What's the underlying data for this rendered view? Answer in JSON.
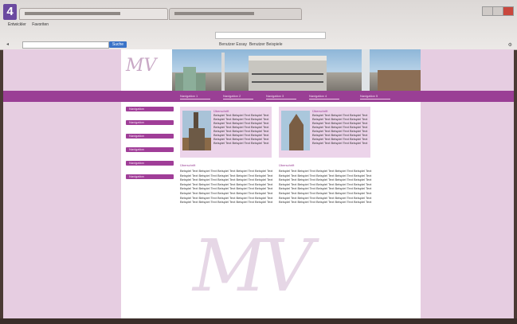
{
  "step_badge": "4",
  "browser": {
    "tabs": [
      "",
      ""
    ],
    "menu": [
      "Entwickler",
      "Favoriten"
    ],
    "url": "",
    "search_placeholder": "",
    "search_button": "Suche",
    "bookmarks": [
      "Benutzer Essay",
      "Benutzer Beispiele"
    ]
  },
  "page": {
    "logo": "MV",
    "nav": [
      "Navigation 1",
      "Navigation 2",
      "Navigation 3",
      "Navigation 4",
      "Navigation 5"
    ],
    "sidebar": [
      "Navigation",
      "Navigation",
      "Navigation",
      "Navigation",
      "Navigation",
      "Navigation"
    ],
    "cards": [
      {
        "title": "Überschrift",
        "text": "Beispiel Text Beispiel Text Beispiel Text Beispiel Text Beispiel Text Beispiel Text Beispiel Text Beispiel Text Beispiel Text Beispiel Text Beispiel Text Beispiel Text Beispiel Text Beispiel Text Beispiel Text Beispiel Text Beispiel Text Beispiel Text Beispiel Text Beispiel Text Beispiel Text Beispiel Text Beispiel Text Beispiel Text"
      },
      {
        "title": "Überschrift",
        "text": "Beispiel Text Beispiel Text Beispiel Text Beispiel Text Beispiel Text Beispiel Text Beispiel Text Beispiel Text Beispiel Text Beispiel Text Beispiel Text Beispiel Text Beispiel Text Beispiel Text Beispiel Text Beispiel Text Beispiel Text Beispiel Text Beispiel Text Beispiel Text Beispiel Text Beispiel Text Beispiel Text Beispiel Text"
      }
    ],
    "columns": [
      {
        "title": "Überschrift",
        "text": "Beispiel Text Beispiel Text Beispiel Text Beispiel Text Beispiel Text Beispiel Text Beispiel Text Beispiel Text Beispiel Text Beispiel Text Beispiel Text Beispiel Text Beispiel Text Beispiel Text Beispiel Text Beispiel Text Beispiel Text Beispiel Text Beispiel Text Beispiel Text Beispiel Text Beispiel Text Beispiel Text Beispiel Text Beispiel Text Beispiel Text Beispiel Text Beispiel Text Beispiel Text Beispiel Text Beispiel Text Beispiel Text Beispiel Text Beispiel Text Beispiel Text Beispiel Text Beispiel Text Beispiel Text Beispiel Text Beispiel Text"
      },
      {
        "title": "Überschrift",
        "text": "Beispiel Text Beispiel Text Beispiel Text Beispiel Text Beispiel Text Beispiel Text Beispiel Text Beispiel Text Beispiel Text Beispiel Text Beispiel Text Beispiel Text Beispiel Text Beispiel Text Beispiel Text Beispiel Text Beispiel Text Beispiel Text Beispiel Text Beispiel Text Beispiel Text Beispiel Text Beispiel Text Beispiel Text Beispiel Text Beispiel Text Beispiel Text Beispiel Text Beispiel Text Beispiel Text Beispiel Text Beispiel Text Beispiel Text Beispiel Text Beispiel Text Beispiel Text Beispiel Text Beispiel Text Beispiel Text Beispiel Text"
      }
    ],
    "watermark": "MV"
  },
  "colors": {
    "accent": "#9a3f95",
    "side_bg": "#e6cde1",
    "card_bg": "#ecd4ea",
    "badge": "#6b4aa0"
  }
}
